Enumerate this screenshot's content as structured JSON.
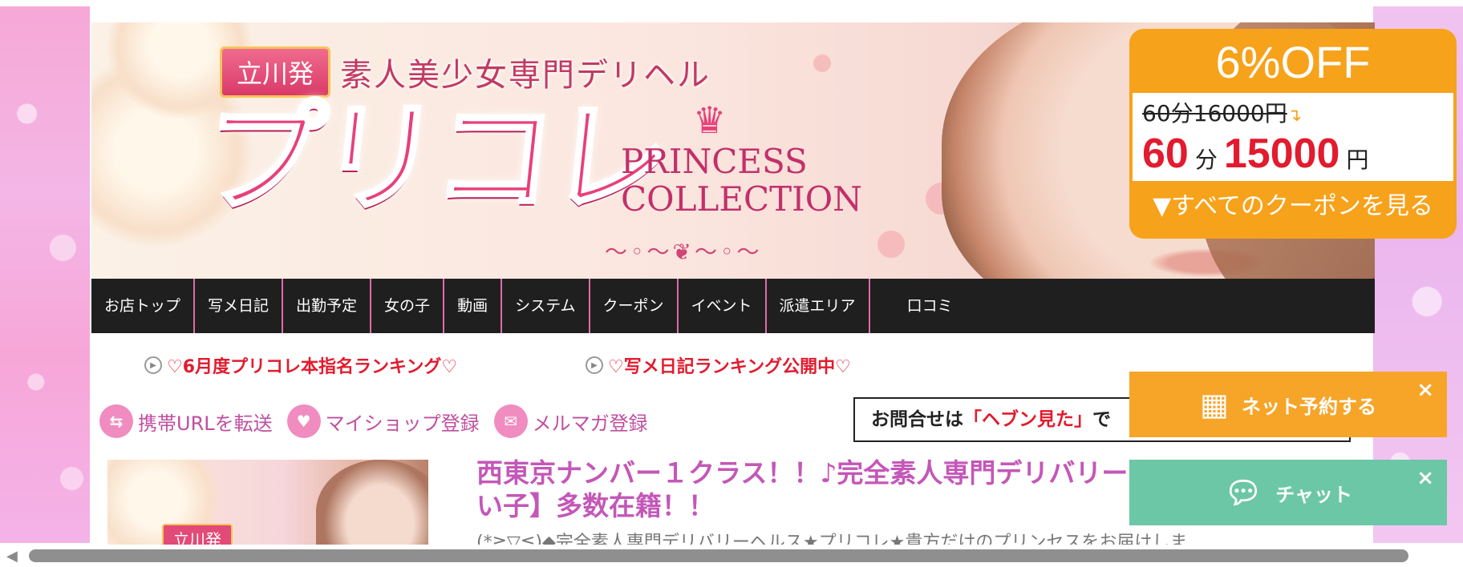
{
  "banner": {
    "area_badge": "立川発",
    "tagline": "素人美少女専門デリヘル",
    "logo": "プリコレ",
    "brand_line1": "PRINCESS",
    "brand_line2": "COLLECTION"
  },
  "coupon": {
    "headline": "6%OFF",
    "old_price": "60分16000円",
    "new_minutes": "60",
    "minutes_unit": "分",
    "new_price": "15000",
    "yen": "円",
    "view_all": "▼すべてのクーポンを見る"
  },
  "nav": {
    "items": [
      "お店トップ",
      "写メ日記",
      "出勤予定",
      "女の子",
      "動画",
      "システム",
      "クーポン",
      "イベント",
      "派遣エリア",
      "口コミ"
    ]
  },
  "rankings": {
    "left": "♡6月度プリコレ本指名ランキング♡",
    "right": "♡写メ日記ランキング公開中♡"
  },
  "util": {
    "mobile_url": "携帯URLを転送",
    "myshop": "マイショップ登録",
    "mailmag": "メルマガ登録"
  },
  "contact": {
    "prefix": "お問合せは",
    "quote": "「ヘブン見た」",
    "suffix": "で"
  },
  "content": {
    "thumb_badge": "立川発",
    "title": "西東京ナンバー１クラス！！♪完全素人専門デリバリー い子】多数在籍！！",
    "description": "(*≧▽≦)◆完全素人専門デリバリーヘルス★プリコレ★貴方だけのプリンセスをお届けしま"
  },
  "floating": {
    "reserve": "ネット予約する",
    "chat": "チャット",
    "close": "×"
  },
  "colors": {
    "accent_orange": "#f7a21b",
    "price_red": "#e21b2e",
    "title_purple": "#c457b8",
    "chat_green": "#6cc7a6",
    "nav_bg": "#1f1f1f"
  }
}
